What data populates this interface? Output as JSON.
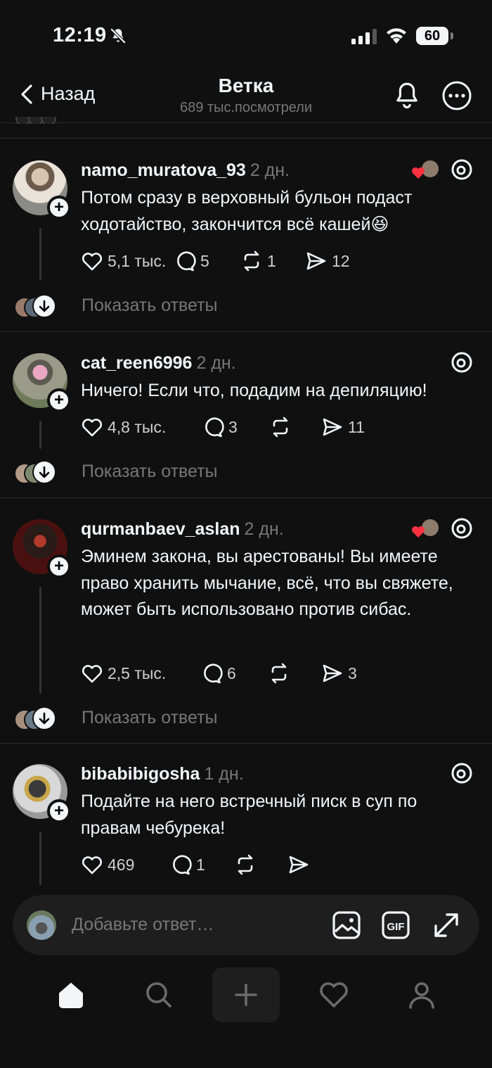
{
  "status": {
    "time": "12:19",
    "battery": "60"
  },
  "nav": {
    "back_label": "Назад",
    "title": "Ветка",
    "subtitle": "689 тыс.посмотрели"
  },
  "posts": [
    {
      "username": "namo_muratova_93",
      "time": "2 дн.",
      "text": "Потом сразу в верховный бульон подаст ходотайство, закончится всё кашей😆",
      "likes": "5,1 тыс.",
      "comments": "5",
      "reposts": "1",
      "shares": "12",
      "show_replies": "Показать ответы"
    },
    {
      "username": "cat_reen6996",
      "time": "2 дн.",
      "text": "Ничего! Если что, подадим на депиляцию!",
      "likes": "4,8 тыс.",
      "comments": "3",
      "reposts": "",
      "shares": "11",
      "show_replies": "Показать ответы"
    },
    {
      "username": "qurmanbaev_aslan",
      "time": "2 дн.",
      "text": "Эминем закона, вы арестованы! Вы имеете право хранить мычание, всё, что вы свяжете, может быть использовано против сибас.",
      "likes": "2,5 тыс.",
      "comments": "6",
      "reposts": "",
      "shares": "3",
      "show_replies": "Показать ответы"
    },
    {
      "username": "bibabibigosha",
      "time": "1 дн.",
      "text": "Подайте на него встречный писк в суп по правам чебурека!",
      "likes": "469",
      "comments": "1",
      "reposts": "",
      "shares": ""
    }
  ],
  "reply": {
    "placeholder": "Добавьте ответ…",
    "gif_label": "GIF"
  },
  "tabbar": {
    "items": [
      "home-icon",
      "search-icon",
      "plus-icon",
      "heart-icon",
      "profile-icon"
    ]
  },
  "colors": {
    "background": "#101010",
    "text": "#f3f5f7",
    "muted": "#777777",
    "like_red": "#ff3040"
  }
}
